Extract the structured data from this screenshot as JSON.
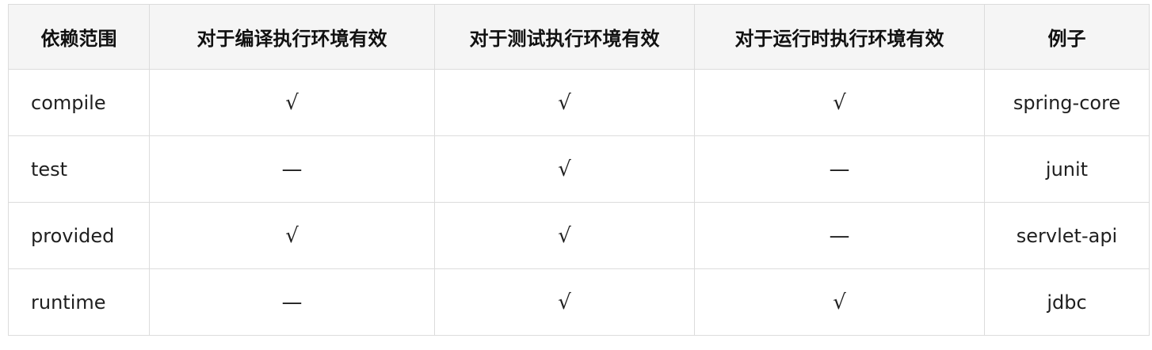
{
  "table": {
    "headers": [
      "依赖范围",
      "对于编译执行环境有效",
      "对于测试执行环境有效",
      "对于运行时执行环境有效",
      "例子"
    ],
    "rows": [
      [
        "compile",
        "√",
        "√",
        "√",
        "spring-core"
      ],
      [
        "test",
        "—",
        "√",
        "—",
        "junit"
      ],
      [
        "provided",
        "√",
        "√",
        "—",
        "servlet-api"
      ],
      [
        "runtime",
        "—",
        "√",
        "√",
        "jdbc"
      ]
    ]
  },
  "colors": {
    "border": "#dcdcdc",
    "header_background": "#f5f5f5",
    "text": "#1f1f1f"
  }
}
